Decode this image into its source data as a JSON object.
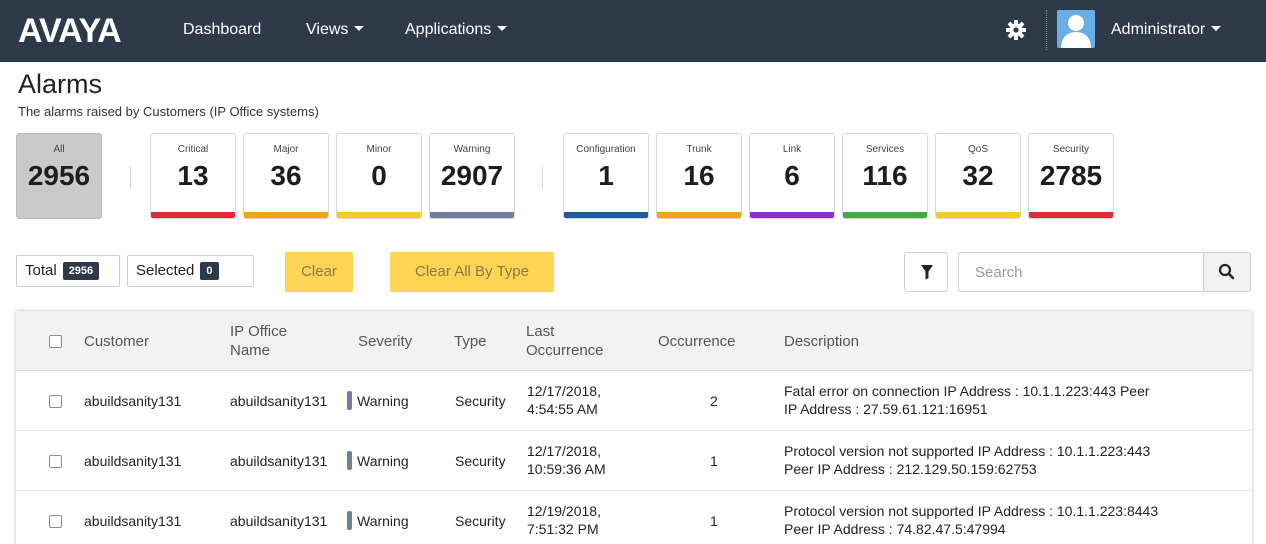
{
  "nav": {
    "logo": "AVAYA",
    "dashboard": "Dashboard",
    "views": "Views",
    "applications": "Applications",
    "user": "Administrator",
    "gear_icon": "gear-icon",
    "avatar_icon": "user-avatar-icon"
  },
  "page": {
    "title": "Alarms",
    "subtitle": "The alarms raised by Customers (IP Office systems)"
  },
  "summary": {
    "all": {
      "label": "All",
      "count": "2956"
    },
    "severity": [
      {
        "label": "Critical",
        "count": "13",
        "color": "#e02b35"
      },
      {
        "label": "Major",
        "count": "36",
        "color": "#f5a21c"
      },
      {
        "label": "Minor",
        "count": "0",
        "color": "#f2cd24"
      },
      {
        "label": "Warning",
        "count": "2907",
        "color": "#6d7f9b"
      }
    ],
    "type": [
      {
        "label": "Configuration",
        "count": "1",
        "color": "#1d5c97"
      },
      {
        "label": "Trunk",
        "count": "16",
        "color": "#f5a21c"
      },
      {
        "label": "Link",
        "count": "6",
        "color": "#8b2fc9"
      },
      {
        "label": "Services",
        "count": "116",
        "color": "#48a844"
      },
      {
        "label": "QoS",
        "count": "32",
        "color": "#f2cd24"
      },
      {
        "label": "Security",
        "count": "2785",
        "color": "#e02b35"
      }
    ]
  },
  "toolbar": {
    "total_label": "Total",
    "total_count": "2956",
    "selected_label": "Selected",
    "selected_count": "0",
    "clear": "Clear",
    "clear_all_by_type": "Clear All By Type",
    "search_placeholder": "Search"
  },
  "table": {
    "headers": {
      "customer": "Customer",
      "ip_office_name_1": "IP Office",
      "ip_office_name_2": "Name",
      "severity": "Severity",
      "type": "Type",
      "last_occurrence_1": "Last",
      "last_occurrence_2": "Occurrence",
      "occurrence": "Occurrence",
      "description": "Description"
    },
    "rows": [
      {
        "customer": "abuildsanity131",
        "ip_office": "abuildsanity131",
        "severity": "Warning",
        "type": "Security",
        "date": "12/17/2018,",
        "time": "4:54:55 AM",
        "occurrence": "2",
        "desc_1": "Fatal error on connection IP Address : 10.1.1.223:443 Peer",
        "desc_2": "IP Address : 27.59.61.121:16951"
      },
      {
        "customer": "abuildsanity131",
        "ip_office": "abuildsanity131",
        "severity": "Warning",
        "type": "Security",
        "date": "12/17/2018,",
        "time": "10:59:36 AM",
        "occurrence": "1",
        "desc_1": "Protocol version not supported IP Address : 10.1.1.223:443",
        "desc_2": "Peer IP Address : 212.129.50.159:62753"
      },
      {
        "customer": "abuildsanity131",
        "ip_office": "abuildsanity131",
        "severity": "Warning",
        "type": "Security",
        "date": "12/19/2018,",
        "time": "7:51:32 PM",
        "occurrence": "1",
        "desc_1": "Protocol version not supported IP Address : 10.1.1.223:8443",
        "desc_2": "Peer IP Address : 74.82.47.5:47994"
      }
    ]
  }
}
